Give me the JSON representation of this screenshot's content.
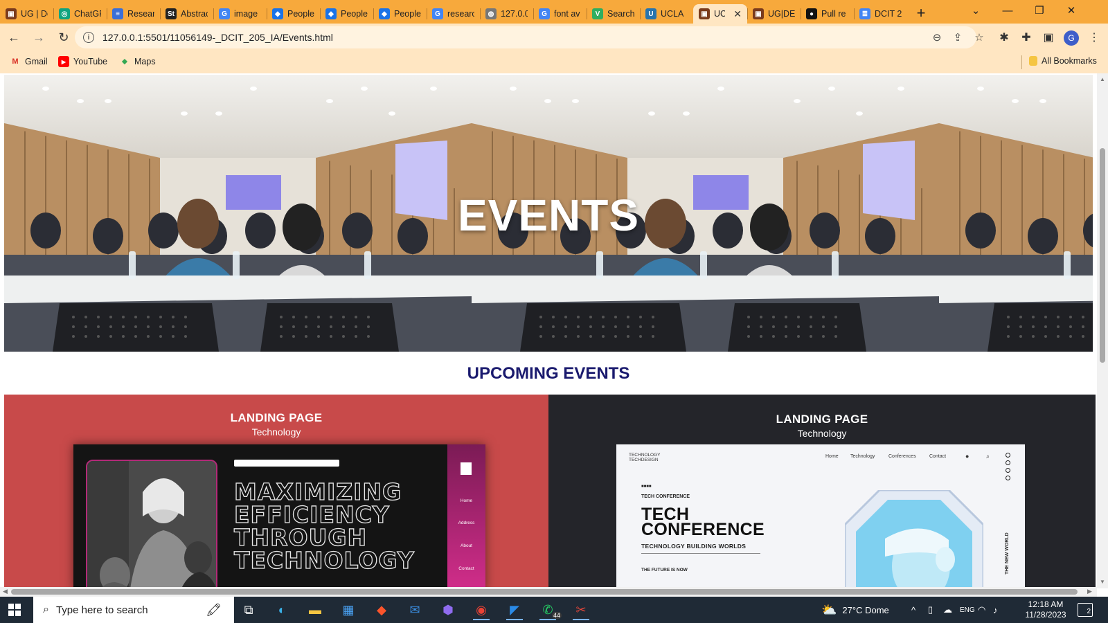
{
  "browser": {
    "tabs": [
      {
        "title": "UG | Dc",
        "icon": "ug-icon",
        "color": "#7a3b1c"
      },
      {
        "title": "ChatGP",
        "icon": "chatgpt-icon",
        "color": "#10a37f"
      },
      {
        "title": "Resear",
        "icon": "forms-icon",
        "color": "#3a6fd8"
      },
      {
        "title": "Abstrac",
        "icon": "scholarcy-icon",
        "color": "#222222"
      },
      {
        "title": "image",
        "icon": "google-icon",
        "color": "#4285f4"
      },
      {
        "title": "People",
        "icon": "people-icon",
        "color": "#1a73e8"
      },
      {
        "title": "People",
        "icon": "people-icon",
        "color": "#1a73e8"
      },
      {
        "title": "People",
        "icon": "people-icon",
        "color": "#1a73e8"
      },
      {
        "title": "researc",
        "icon": "google-icon",
        "color": "#4285f4"
      },
      {
        "title": "127.0.0",
        "icon": "globe-icon",
        "color": "#777777"
      },
      {
        "title": "font av",
        "icon": "google-icon",
        "color": "#4285f4"
      },
      {
        "title": "Search",
        "icon": "search-v-icon",
        "color": "#2fae60"
      },
      {
        "title": "UCLA",
        "icon": "ucla-icon",
        "color": "#2774ae"
      },
      {
        "title": "UC",
        "icon": "ug-icon",
        "color": "#7a3b1c",
        "active": true
      },
      {
        "title": "UG|DE",
        "icon": "ug-icon",
        "color": "#7a3b1c"
      },
      {
        "title": "Pull re",
        "icon": "github-icon",
        "color": "#111111"
      },
      {
        "title": "DCIT 2",
        "icon": "docs-icon",
        "color": "#4285f4"
      }
    ],
    "url": "127.0.0.1:5501/11056149-_DCIT_205_IA/Events.html",
    "bookmarks": [
      {
        "label": "Gmail",
        "icon": "gmail-icon"
      },
      {
        "label": "YouTube",
        "icon": "youtube-icon"
      },
      {
        "label": "Maps",
        "icon": "maps-icon"
      }
    ],
    "all_bookmarks": "All Bookmarks",
    "profile_initial": "G"
  },
  "page": {
    "hero_title": "EVENTS",
    "section_title": "UPCOMING EVENTS",
    "cards": [
      {
        "heading": "LANDING PAGE",
        "subheading": "Technology",
        "mockup_headline": [
          "MAXIMIZING",
          "EFFICIENCY",
          "THROUGH",
          "TECHNOLOGY"
        ],
        "mockup_menu": [
          "Home",
          "Address",
          "About",
          "Contact"
        ],
        "bg": "#c84a4a"
      },
      {
        "heading": "LANDING PAGE",
        "subheading": "Technology",
        "brand": [
          "TECHNOLOGY",
          "TECHDESIGN"
        ],
        "nav": [
          "Home",
          "Technology",
          "Conferences",
          "Contact"
        ],
        "tag": "TECH CONFERENCE",
        "headline": [
          "TECH",
          "CONFERENCE"
        ],
        "subline": "TECHNOLOGY BUILDING WORLDS",
        "footer": "THE FUTURE IS NOW",
        "vertical": "THE NEW WORLD",
        "bg": "#24252a"
      }
    ],
    "title_color": "#1a1a6e"
  },
  "taskbar": {
    "search_placeholder": "Type here to search",
    "weather": "27°C  Dome",
    "time": "12:18 AM",
    "date": "11/28/2023",
    "whatsapp_badge": "44",
    "notifications": "2",
    "language": "ENG"
  }
}
